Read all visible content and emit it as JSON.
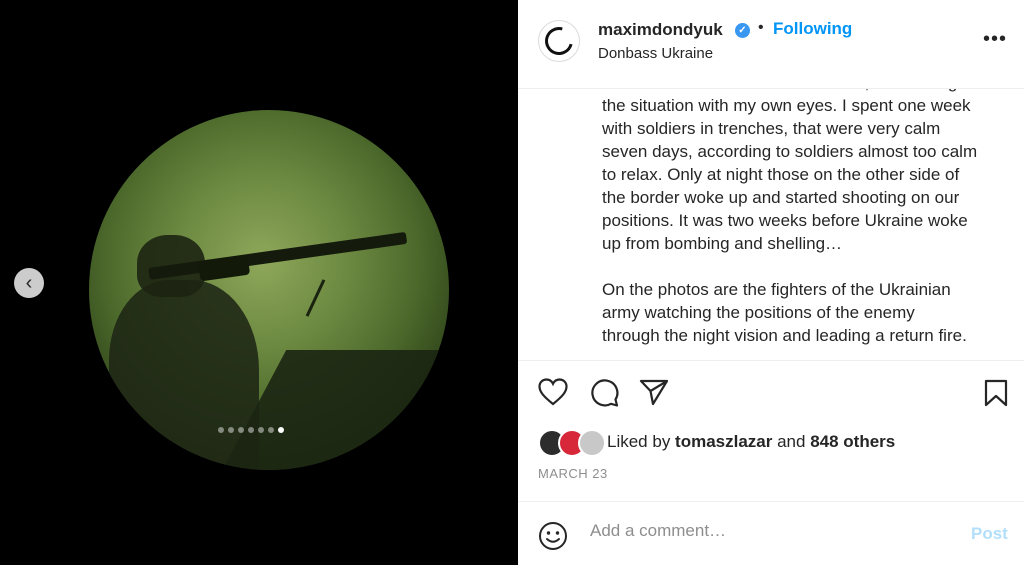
{
  "post": {
    "username": "maximdondyuk",
    "verified_icon": "verified-badge-icon",
    "separator": "•",
    "follow_label": "Following",
    "location": "Donbass Ukraine",
    "more_label": "•••"
  },
  "media": {
    "prev_label": "‹",
    "slide_count": 7,
    "active_slide": 7
  },
  "caption": {
    "text": "the borderline with so-called LDNR, and seeing\nthe situation with my own eyes. I spent one week\nwith soldiers in trenches, that were very calm\nseven days, according to soldiers almost too calm\nto relax. Only at night those on the other side of\nthe border woke up and started shooting on our\npositions. It was two weeks before Ukraine woke\nup from bombing and shelling…\n\nOn the photos are the fighters of the Ukrainian\narmy watching the positions of the enemy\nthrough the night vision and leading a return fire."
  },
  "actions": {
    "icons": [
      "heart-icon",
      "comment-icon",
      "share-icon",
      "bookmark-icon"
    ]
  },
  "likes": {
    "prefix": "Liked by ",
    "user": "tomaszlazar",
    "middle": " and ",
    "others": "848 others"
  },
  "date": "MARCH 23",
  "comment": {
    "placeholder": "Add a comment…",
    "post_label": "Post"
  },
  "colors": {
    "accent": "#0095f6",
    "post_disabled": "#b2dffc",
    "verified": "#3897f0"
  }
}
